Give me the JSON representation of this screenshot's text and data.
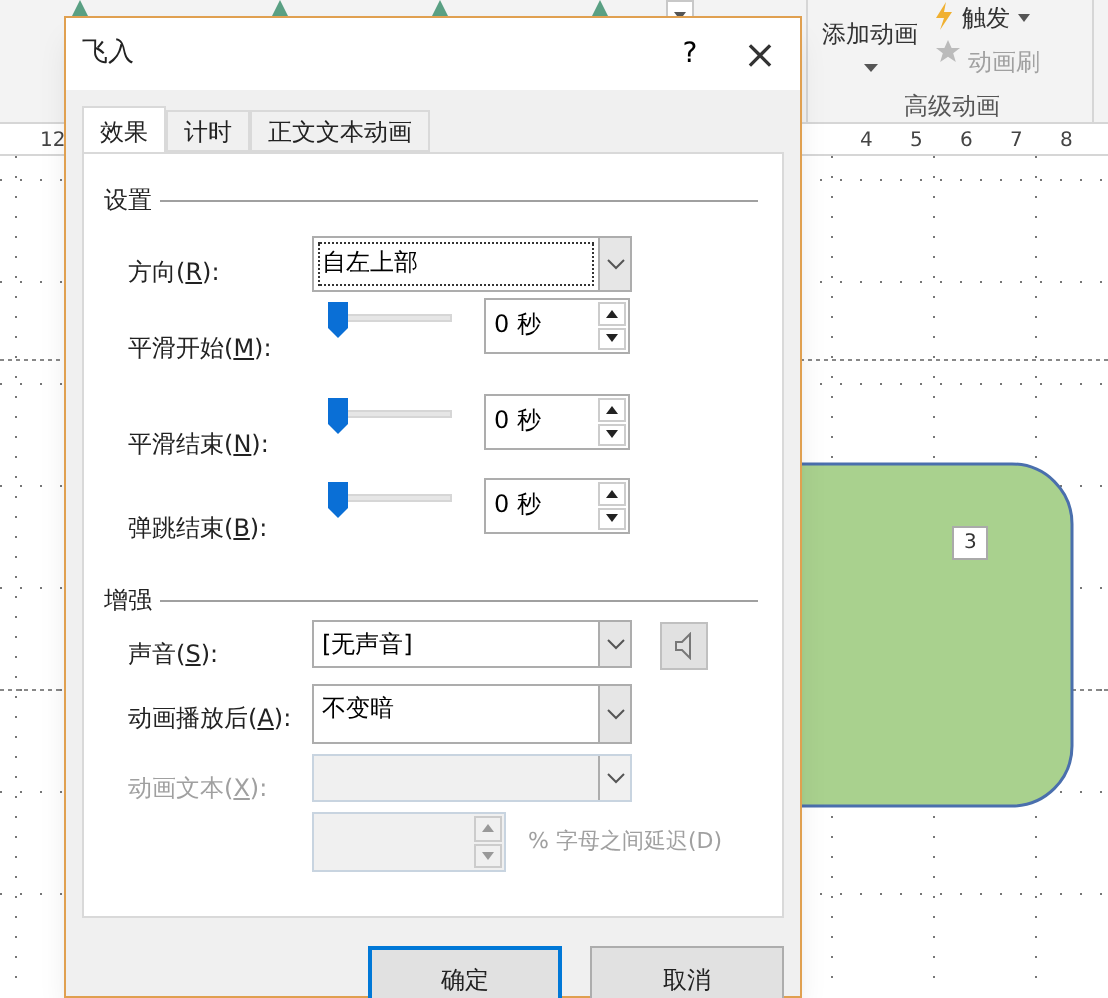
{
  "ribbon": {
    "add_animation": "添加动画",
    "trigger": "触发",
    "painter": {
      "label": "动画刷",
      "disabled": true
    },
    "group_label": "高级动画"
  },
  "ruler": {
    "left_labels": [
      "12"
    ],
    "right_labels": [
      "4",
      "5",
      "6",
      "7",
      "8"
    ]
  },
  "slide": {
    "shape_label": "3"
  },
  "dialog": {
    "title": "飞入",
    "help": "?",
    "close": "×",
    "tabs": [
      {
        "label": "效果",
        "selected": true
      },
      {
        "label": "计时",
        "selected": false
      },
      {
        "label": "正文文本动画",
        "selected": false
      }
    ],
    "settings": {
      "heading": "设置",
      "direction": {
        "pre": "方向(",
        "key": "R",
        "post": "):",
        "value": "自左上部"
      },
      "sliders": [
        {
          "pre": "平滑开始(",
          "key": "M",
          "post": "):",
          "level": 0,
          "value": "0 秒"
        },
        {
          "pre": "平滑结束(",
          "key": "N",
          "post": "):",
          "level": 0,
          "value": "0 秒"
        },
        {
          "pre": "弹跳结束(",
          "key": "B",
          "post": "):",
          "level": 0,
          "value": "0 秒"
        }
      ]
    },
    "enhance": {
      "heading": "增强",
      "rows": [
        {
          "pre": "声音(",
          "key": "S",
          "post": "):",
          "value": "[无声音]",
          "disabled": false,
          "speaker": true
        },
        {
          "pre": "动画播放后(",
          "key": "A",
          "post": "):",
          "value": "不变暗",
          "disabled": false,
          "speaker": false
        },
        {
          "pre": "动画文本(",
          "key": "X",
          "post": "):",
          "value": "",
          "disabled": true,
          "speaker": false
        }
      ],
      "delay": {
        "label": "% 字母之间延迟(D)",
        "disabled": true
      }
    },
    "buttons": [
      {
        "label": "确定",
        "default": true
      },
      {
        "label": "取消",
        "default": false
      }
    ]
  }
}
